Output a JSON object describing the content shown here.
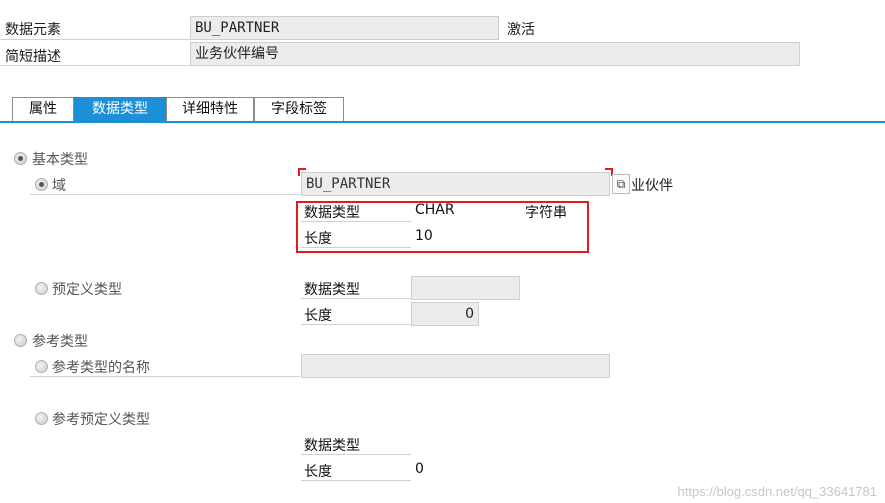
{
  "header": {
    "data_element_label": "数据元素",
    "data_element_value": "BU_PARTNER",
    "status": "激活",
    "short_desc_label": "简短描述",
    "short_desc_value": "业务伙伴编号"
  },
  "tabs": [
    {
      "label": "属性",
      "active": false
    },
    {
      "label": "数据类型",
      "active": true
    },
    {
      "label": "详细特性",
      "active": false
    },
    {
      "label": "字段标签",
      "active": false
    }
  ],
  "elementary": {
    "label": "基本类型",
    "domain_label": "域",
    "domain_value": "BU_PARTNER",
    "domain_desc": "业伙伴",
    "datatype_label": "数据类型",
    "datatype_value": "CHAR",
    "datatype_desc": "字符串",
    "length_label": "长度",
    "length_value": "10"
  },
  "predefined": {
    "label": "预定义类型",
    "datatype_label": "数据类型",
    "datatype_value": "",
    "length_label": "长度",
    "length_value": "0"
  },
  "reference": {
    "label": "参考类型",
    "ref_name_label": "参考类型的名称",
    "ref_name_value": "",
    "ref_predef_label": "参考预定义类型",
    "datatype_label": "数据类型",
    "length_label": "长度",
    "length_value": "0"
  },
  "watermark": "https://blog.csdn.net/qq_33641781"
}
